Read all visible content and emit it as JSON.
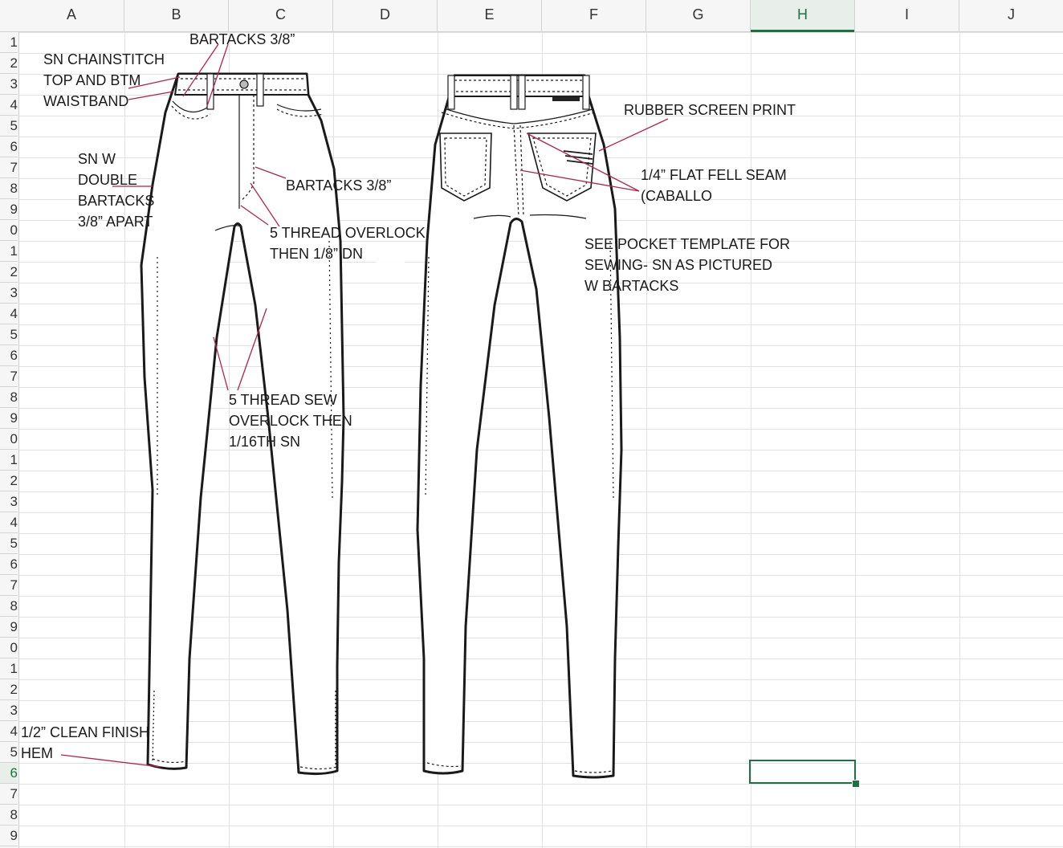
{
  "columns": [
    "A",
    "B",
    "C",
    "D",
    "E",
    "F",
    "G",
    "H",
    "I",
    "J"
  ],
  "active_column": "H",
  "rows": [
    "1",
    "2",
    "3",
    "4",
    "5",
    "6",
    "7",
    "8",
    "9",
    "0",
    "1",
    "2",
    "3",
    "4",
    "5",
    "6",
    "7",
    "8",
    "9",
    "0",
    "1",
    "2",
    "3",
    "4",
    "5",
    "6",
    "7",
    "8",
    "9",
    "0",
    "1",
    "2",
    "3",
    "4",
    "5",
    "6",
    "7",
    "8",
    "9"
  ],
  "active_row_index": 35,
  "selected_cell": "H36",
  "annotations": {
    "bartacks_top": "BARTACKS 3/8”",
    "chainstitch_1": "SN CHAINSTITCH",
    "chainstitch_2": "TOP AND BTM",
    "chainstitch_3": "WAISTBAND",
    "double_bartacks_1": "SN W",
    "double_bartacks_2": "DOUBLE",
    "double_bartacks_3": "BARTACKS",
    "double_bartacks_4": "3/8” APART",
    "bartacks_fly": "BARTACKS 3/8”",
    "overlock_1": "5 THREAD OVERLOCK",
    "overlock_2": "THEN 1/8” DN",
    "sew_overlock_1": "5 THREAD SEW",
    "sew_overlock_2": "OVERLOCK THEN",
    "sew_overlock_3": "1/16TH SN",
    "hem_1": "1/2” CLEAN FINISH",
    "hem_2": "HEM",
    "screen_print": "RUBBER SCREEN PRINT",
    "flat_fell_1": "1/4” FLAT FELL SEAM",
    "flat_fell_2": "(CABALLO",
    "pocket_1": "SEE POCKET TEMPLATE FOR",
    "pocket_2": "SEWING- SN AS PICTURED",
    "pocket_3": "W BARTACKS"
  },
  "colors": {
    "accent": "#1e7145",
    "leader_line": "#b5224a",
    "outline": "#1a1a1a"
  }
}
